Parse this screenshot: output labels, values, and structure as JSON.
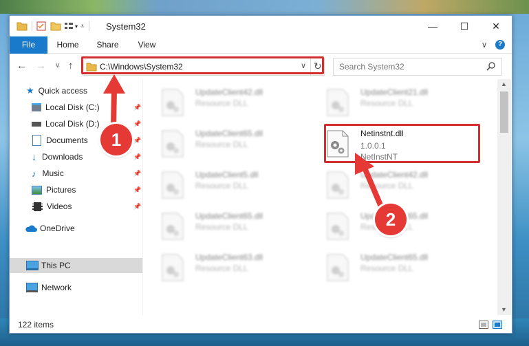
{
  "window": {
    "title": "System32",
    "minimize_glyph": "—",
    "maximize_glyph": "☐",
    "close_glyph": "✕"
  },
  "ribbon": {
    "tabs": [
      "File",
      "Home",
      "Share",
      "View"
    ],
    "expand_glyph": "∨",
    "help_glyph": "?"
  },
  "address": {
    "path": "C:\\Windows\\System32",
    "dropdown_glyph": "∨",
    "refresh_glyph": "↻"
  },
  "search": {
    "placeholder": "Search System32"
  },
  "sidebar": {
    "quick_access": "Quick access",
    "items": [
      {
        "label": "Local Disk (C:)",
        "icon": "drive-icon",
        "pinned": true
      },
      {
        "label": "Local Disk (D:)",
        "icon": "drive-icon",
        "pinned": true
      },
      {
        "label": "Documents",
        "icon": "documents-icon",
        "pinned": true
      },
      {
        "label": "Downloads",
        "icon": "downloads-icon",
        "pinned": true
      },
      {
        "label": "Music",
        "icon": "music-icon",
        "pinned": true
      },
      {
        "label": "Pictures",
        "icon": "pictures-icon",
        "pinned": true
      },
      {
        "label": "Videos",
        "icon": "videos-icon",
        "pinned": true
      }
    ],
    "onedrive": "OneDrive",
    "this_pc": "This PC",
    "network": "Network"
  },
  "files": {
    "left": [
      {
        "name": "UpdateClient42.dll",
        "desc": "Resource DLL"
      },
      {
        "name": "UpdateClient65.dll",
        "desc": "Resource DLL"
      },
      {
        "name": "UpdateClient5.dll",
        "desc": "Resource DLL"
      },
      {
        "name": "UpdateClient65.dll",
        "desc": "Resource DLL"
      },
      {
        "name": "UpdateClient63.dll",
        "desc": "Resource DLL"
      }
    ],
    "right": [
      {
        "name": "UpdateClient21.dll",
        "desc": "Resource DLL"
      },
      {
        "name": "UpdateClient42.dll",
        "desc": "Resource DLL"
      },
      {
        "name": "UpdateClient65.dll",
        "desc": "Resource DLL"
      },
      {
        "name": "UpdateClient65.dll",
        "desc": "Resource DLL"
      }
    ],
    "highlighted": {
      "name": "Netinstnt.dll",
      "version": "1.0.0.1",
      "desc": "NetInstNT"
    }
  },
  "status": {
    "item_count": "122 items"
  },
  "callouts": [
    "1",
    "2"
  ],
  "colors": {
    "accent": "#1979ca",
    "highlight": "#d32f2f",
    "callout": "#e53935"
  }
}
